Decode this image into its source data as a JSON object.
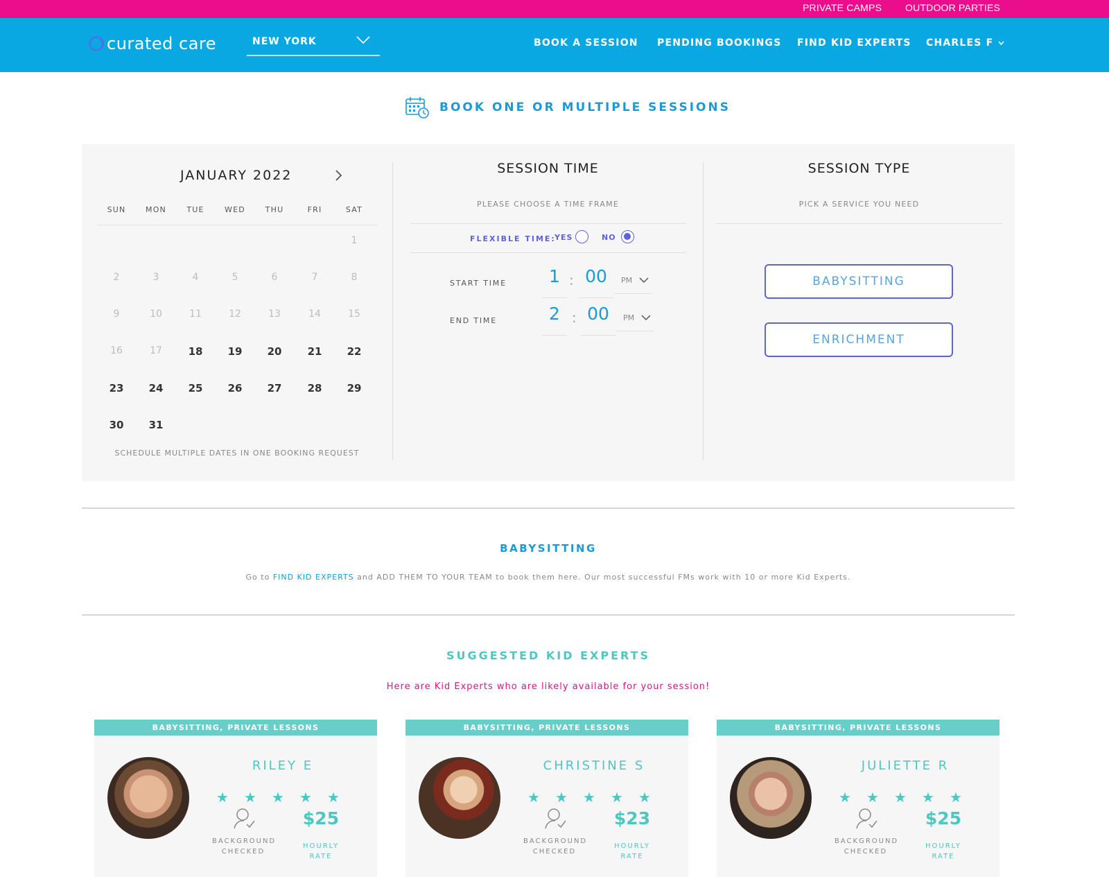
{
  "topbar": {
    "links": [
      "PRIVATE CAMPS",
      "OUTDOOR PARTIES"
    ]
  },
  "header": {
    "logo": "curated care",
    "city": "NEW YORK",
    "nav": [
      "BOOK A SESSION",
      "PENDING BOOKINGS",
      "FIND KID EXPERTS",
      "CHARLES F"
    ]
  },
  "page": {
    "title": "BOOK ONE OR MULTIPLE SESSIONS"
  },
  "calendar": {
    "month": "JANUARY 2022",
    "weekdays": [
      "SUN",
      "MON",
      "TUE",
      "WED",
      "THU",
      "FRI",
      "SAT"
    ],
    "past_days": [
      "1",
      "2",
      "3",
      "4",
      "5",
      "6",
      "7",
      "8",
      "9",
      "10",
      "11",
      "12",
      "13",
      "14",
      "15",
      "16",
      "17"
    ],
    "active_days": [
      "18",
      "19",
      "20",
      "21",
      "22",
      "23",
      "24",
      "25",
      "26",
      "27",
      "28",
      "29",
      "30",
      "31"
    ],
    "note": "SCHEDULE MULTIPLE DATES IN ONE BOOKING REQUEST"
  },
  "session_time": {
    "title": "SESSION TIME",
    "subtitle": "PLEASE CHOOSE A TIME FRAME",
    "flexible_label": "FLEXIBLE TIME:",
    "yes": "YES",
    "no": "NO",
    "flexible_selected": "NO",
    "start_label": "START TIME",
    "start_hour": "1",
    "start_min": "00",
    "start_ampm": "PM",
    "end_label": "END TIME",
    "end_hour": "2",
    "end_min": "00",
    "end_ampm": "PM"
  },
  "session_type": {
    "title": "SESSION TYPE",
    "subtitle": "PICK A SERVICE YOU NEED",
    "options": [
      "BABYSITTING",
      "ENRICHMENT"
    ]
  },
  "babysitting": {
    "title": "BABYSITTING",
    "text_pre": "Go to",
    "text_link1": "FIND KID EXPERTS",
    "text_mid": "and",
    "text_link2": "ADD THEM TO YOUR TEAM",
    "text_post": "to book them here. Our most successful FMs work with 10 or more Kid Experts."
  },
  "suggested": {
    "title": "SUGGESTED KID EXPERTS",
    "subtitle": "Here are Kid Experts who are likely available for your session!",
    "bg_label_1": "BACKGROUND",
    "bg_label_2": "CHECKED",
    "rate_label_1": "HOURLY",
    "rate_label_2": "RATE",
    "experts": [
      {
        "tags": "BABYSITTING, PRIVATE LESSONS",
        "name": "RILEY E",
        "rating": 5,
        "rate": "$25"
      },
      {
        "tags": "BABYSITTING, PRIVATE LESSONS",
        "name": "CHRISTINE S",
        "rating": 5,
        "rate": "$23"
      },
      {
        "tags": "BABYSITTING, PRIVATE LESSONS",
        "name": "JULIETTE R",
        "rating": 5,
        "rate": "$25"
      }
    ]
  },
  "colors": {
    "pink": "#ea0d8c",
    "blue": "#0aa8e2",
    "purple": "#5e63d8",
    "teal": "#4ec6c2"
  }
}
